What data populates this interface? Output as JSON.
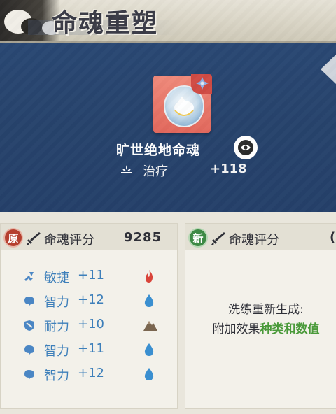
{
  "header": {
    "title": "命魂重塑"
  },
  "item": {
    "name": "旷世绝地命魂",
    "stat_label": "治疗",
    "stat_value": "+118"
  },
  "original": {
    "badge": "原",
    "score_label": "命魂评分",
    "score": "9285",
    "attributes": [
      {
        "name": "敏捷",
        "value": "+11",
        "icon": "agility-icon",
        "element": "fire-icon"
      },
      {
        "name": "智力",
        "value": "+12",
        "icon": "intellect-icon",
        "element": "water-icon"
      },
      {
        "name": "耐力",
        "value": "+10",
        "icon": "endurance-icon",
        "element": "earth-icon"
      },
      {
        "name": "智力",
        "value": "+11",
        "icon": "intellect-icon",
        "element": "water-icon"
      },
      {
        "name": "智力",
        "value": "+12",
        "icon": "intellect-icon",
        "element": "water-icon"
      }
    ]
  },
  "new": {
    "badge": "新",
    "score_label": "命魂评分",
    "score_partial": "(",
    "note_line1": "洗练重新生成:",
    "note_line2_prefix": "附加效果",
    "note_line2_highlight": "种类和数值"
  },
  "colors": {
    "accent_blue": "#3d7fba",
    "highlight_green": "#4a9a3a",
    "fire": "#d9443a",
    "water": "#3a8fd0",
    "earth": "#7a6650"
  }
}
